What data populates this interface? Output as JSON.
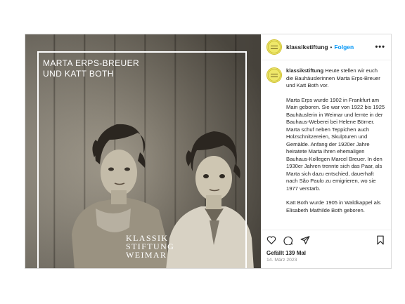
{
  "post": {
    "media": {
      "overlay_title": [
        "MARTA ERPS-BREUER",
        "UND KATT BOTH"
      ],
      "logo_text": [
        "KLASSIK",
        "STIFTUNG",
        "WEIMAR"
      ]
    },
    "header": {
      "username": "klassikstiftung",
      "separator": "•",
      "follow_label": "Folgen",
      "more_label": "•••"
    },
    "caption": {
      "username": "klassikstiftung",
      "intro": "Heute stellen wir euch die Bauhäuslerinnen Marta Erps-Breuer und Katt Both vor.",
      "paragraph2": "Marta Erps wurde 1902 in Frankfurt am Main geboren. Sie war von 1922 bis 1925 Bauhäuslerin in Weimar und lernte in der Bauhaus-Weberei bei Helene Börner. Marta schuf neben Teppichen auch Holzschnitzereien, Skulpturen und Gemälde. Anfang der 1920er Jahre heiratete Marta ihren ehemaligen Bauhaus-Kollegen Marcel Breuer. In den 1930er Jahren trennte sich das Paar, als Marta sich dazu entschied, dauerhaft nach São Paulo zu emigrieren, wo sie 1977 verstarb.",
      "paragraph3": "Katt Both wurde 1905 in Waldkappel als Elisabeth Mathilde Both geboren."
    },
    "actions": {
      "icons": [
        "heart-icon",
        "comment-icon",
        "share-icon",
        "bookmark-icon"
      ]
    },
    "likes": "Gefällt 139 Mal",
    "date": "14. März 2023",
    "colors": {
      "accent": "#0095f6",
      "border": "#dbdbdb",
      "muted": "#8e8e8e"
    }
  }
}
